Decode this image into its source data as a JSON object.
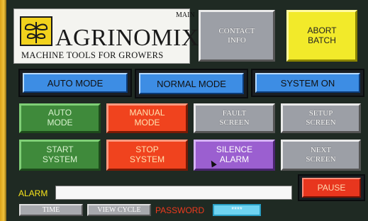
{
  "screen": {
    "title": "MAIN"
  },
  "brand": {
    "name": "AGRINOMIX",
    "tagline": "MACHINE TOOLS FOR GROWERS"
  },
  "header_buttons": {
    "contact": "CONTACT\nINFO",
    "abort": "ABORT\nBATCH"
  },
  "modes": {
    "auto": "AUTO MODE",
    "normal": "NORMAL MODE",
    "system": "SYSTEM ON"
  },
  "grid": {
    "auto_mode": "AUTO\nMODE",
    "manual_mode": "MANUAL\nMODE",
    "fault_screen": "FAULT\nSCREEN",
    "setup_screen": "SETUP\nSCREEN",
    "start_system": "START\nSYSTEM",
    "stop_system": "STOP\nSYSTEM",
    "silence_alarm": "SILENCE\nALARM",
    "next_screen": "NEXT\nSCREEN"
  },
  "alarm": {
    "label": "ALARM",
    "value": ""
  },
  "pause": "PAUSE",
  "footer": {
    "time": "TIME",
    "view_cycle": "VIEW CYCLE",
    "password_label": "PASSWORD",
    "password_value": "****"
  },
  "colors": {
    "accent_blue": "#3d8de4",
    "yellow": "#f2ea2a",
    "green": "#3f8a3b",
    "red": "#f0431e",
    "purple": "#9b5fd0"
  }
}
